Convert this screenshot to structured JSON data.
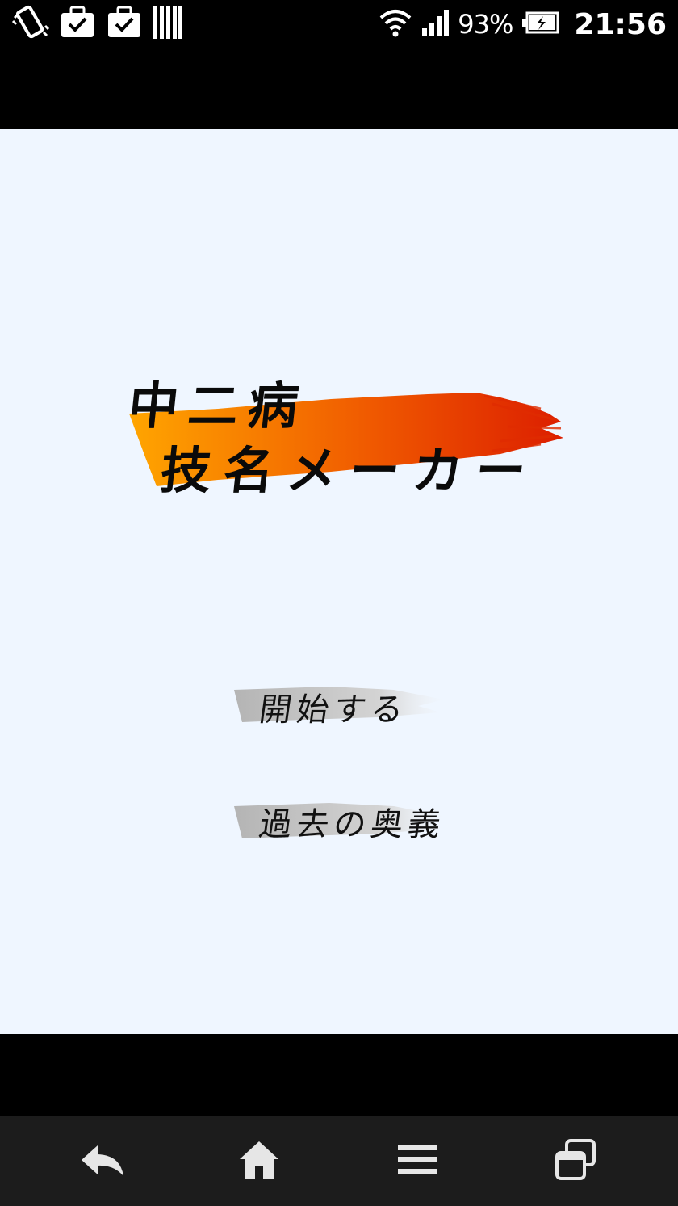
{
  "status_bar": {
    "left_icons": [
      "vibrate-icon",
      "briefcase-check-icon",
      "briefcase-check-icon",
      "barcode-icon"
    ],
    "right_icons": [
      "wifi-icon",
      "signal-icon",
      "battery-charging-icon"
    ],
    "battery_percent": "93%",
    "time": "21:56"
  },
  "app": {
    "background_color": "#eff6ff",
    "title_line1": "中二病",
    "title_line2": "技名メーカー",
    "title_brush_colors": [
      "#ffa500",
      "#dc1e00"
    ],
    "buttons": {
      "start_label": "開始する",
      "past_label": "過去の奥義"
    }
  },
  "nav_bar": {
    "icons": [
      "back-icon",
      "home-icon",
      "menu-icon",
      "windows-icon"
    ]
  }
}
